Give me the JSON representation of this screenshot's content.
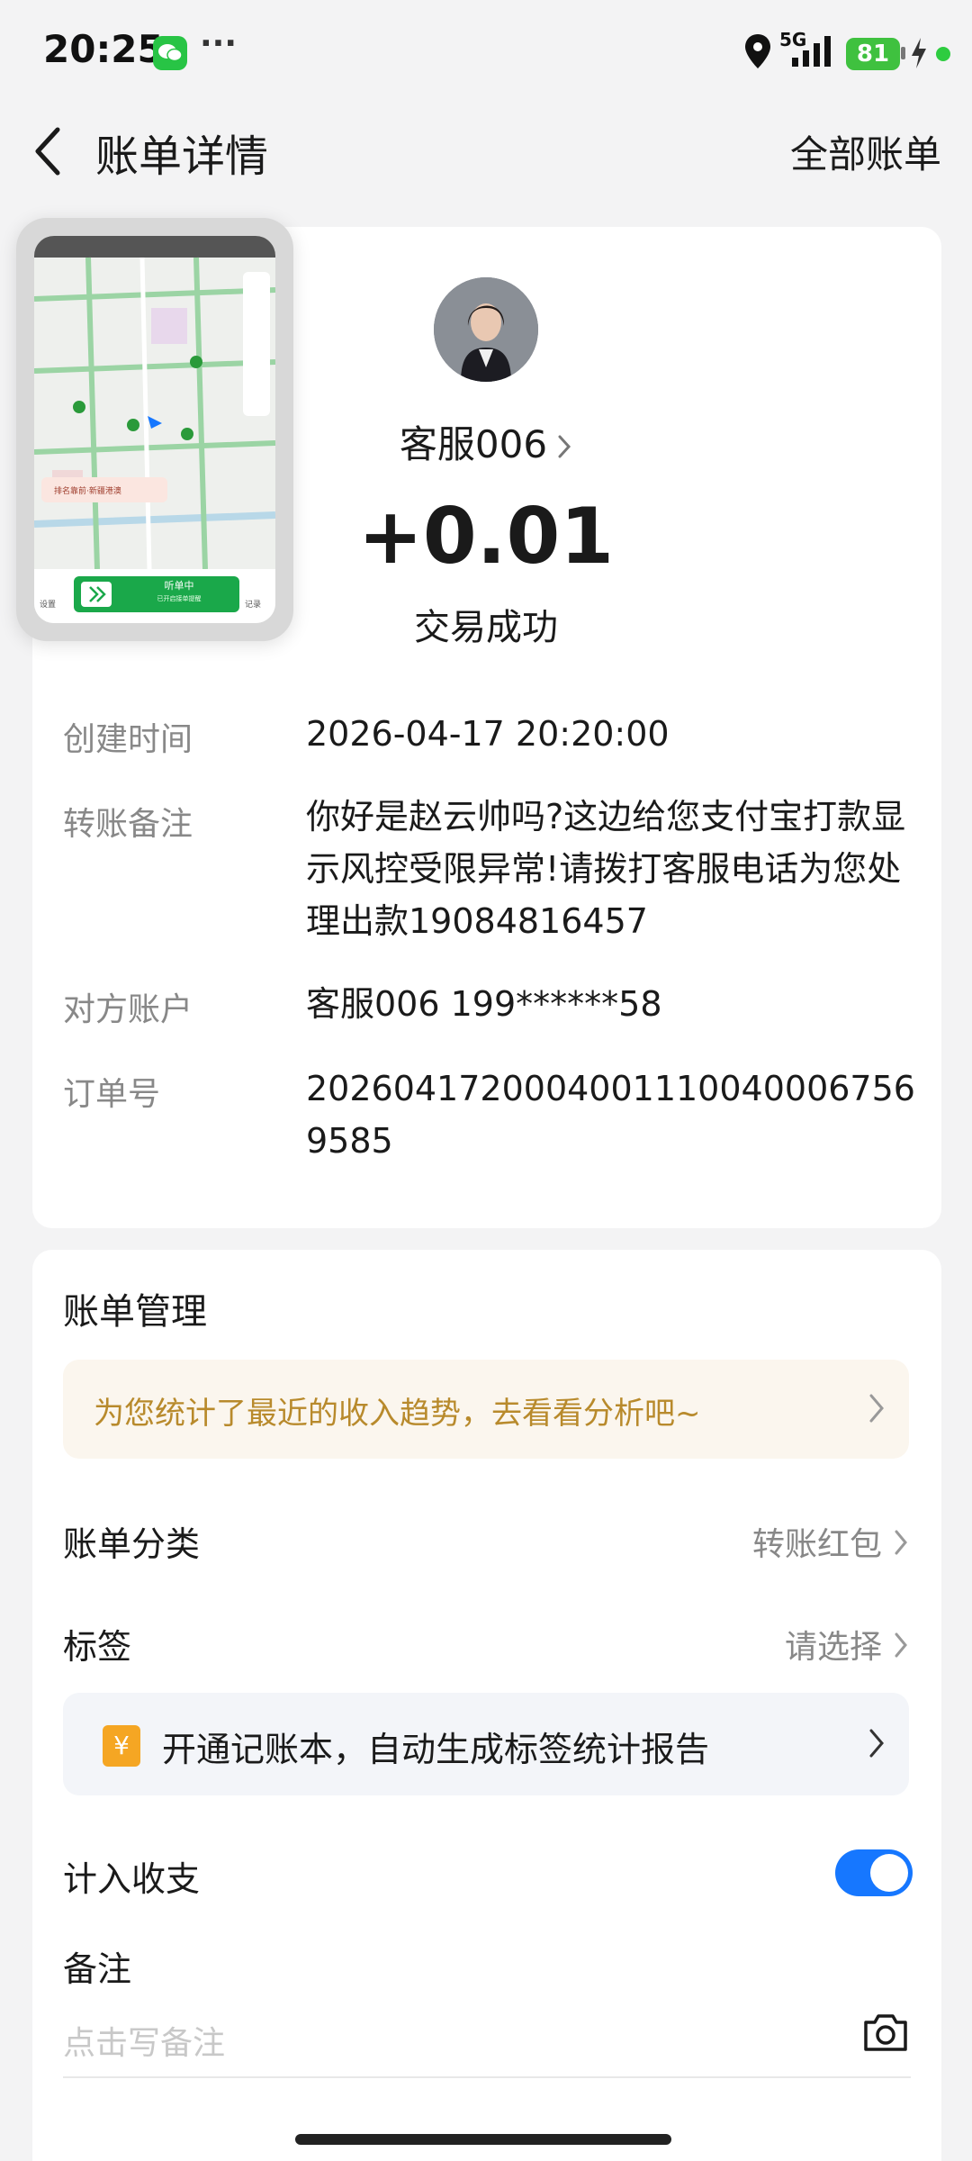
{
  "status_bar": {
    "time": "20:25",
    "more": "···",
    "network": "5G",
    "battery": "81"
  },
  "nav": {
    "title": "账单详情",
    "all_bills": "全部账单"
  },
  "header": {
    "payee": "客服006",
    "amount": "+0.01",
    "status": "交易成功"
  },
  "details": [
    {
      "label": "创建时间",
      "value": "2026-04-17 20:20:00"
    },
    {
      "label": "转账备注",
      "value": "你好是赵云帅吗?这边给您支付宝打款显示风控受限异常!请拨打客服电话为您处理出款19084816457"
    },
    {
      "label": "对方账户",
      "value": "客服006 199******58"
    },
    {
      "label": "订单号",
      "value": "20260417200040011100400067569585"
    }
  ],
  "management": {
    "title": "账单管理",
    "insight": "为您统计了最近的收入趋势，去看看分析吧~",
    "category_label": "账单分类",
    "category_value": "转账红包",
    "tag_label": "标签",
    "tag_value": "请选择",
    "promo_icon": "¥",
    "promo": "开通记账本，自动生成标签统计报告",
    "include_label": "计入收支",
    "include_enabled": true,
    "note_label": "备注",
    "note_placeholder": "点击写备注"
  },
  "pip": {
    "toast": "排名靠前·新疆港澳",
    "listening": "听单中",
    "listening_sub": "已开启接单提醒",
    "left_btn": "设置",
    "right_btn": "记录"
  },
  "colors": {
    "accent": "#1677ff",
    "insight_text": "#b88a2c",
    "promo_icon": "#f5a623"
  }
}
